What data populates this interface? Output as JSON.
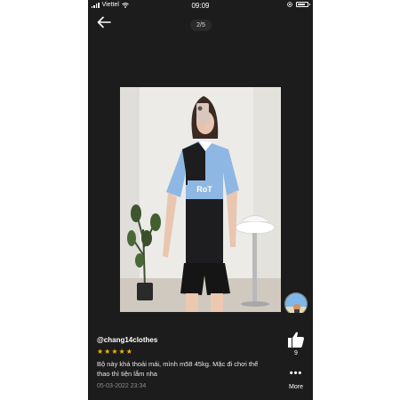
{
  "status_bar": {
    "carrier": "Viettel",
    "time": "09:09"
  },
  "viewer": {
    "counter": "2/5"
  },
  "review": {
    "username": "@chang14clothes",
    "rating": 5,
    "rating_max": 5,
    "text": "Bộ này khá thoải mái, mình m58 45kg. Mặc đi chơi thể thao thì tiện lắm nha",
    "date": "05-03-2022 23:34"
  },
  "actions": {
    "like_count": "9",
    "more_label": "More"
  },
  "colors": {
    "background": "#1c1c1c",
    "star": "#f5b301",
    "shirt_blue": "#8fb7e3",
    "shirt_black": "#1d1d1f"
  },
  "icons": [
    "signal-icon",
    "wifi-icon",
    "location-icon",
    "battery-icon",
    "back-arrow-icon",
    "thumbs-up-icon",
    "more-dots-icon",
    "star-icon"
  ]
}
